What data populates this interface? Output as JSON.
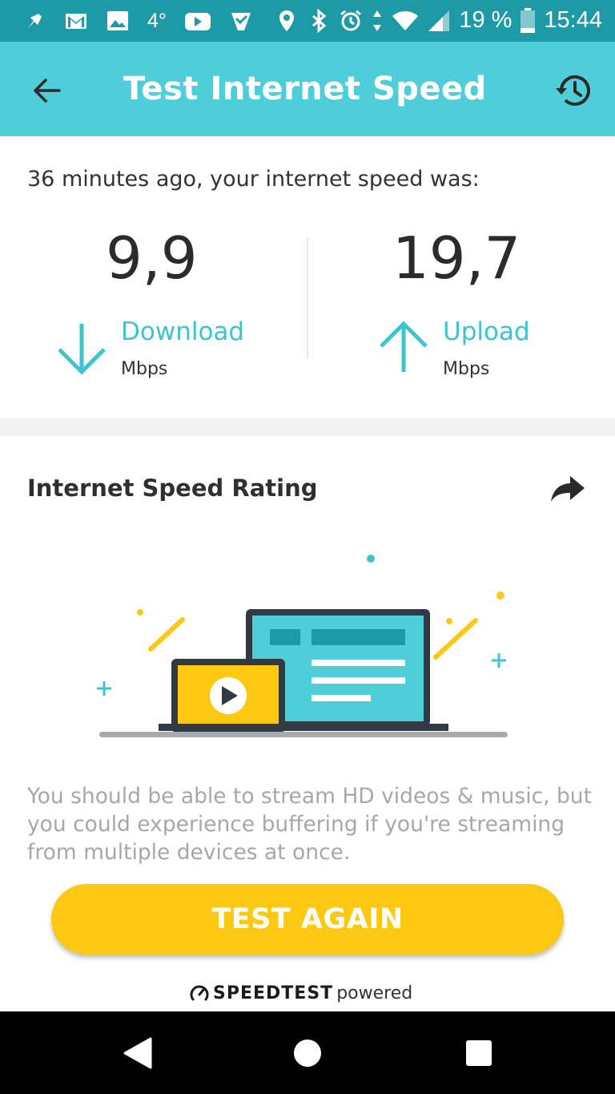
{
  "status_bar": {
    "left_icons": [
      "pin-icon",
      "gmail-icon",
      "gallery-icon",
      "temperature",
      "youtube-icon",
      "check-tag-icon"
    ],
    "temperature": "4°",
    "right_icons": [
      "location-icon",
      "bluetooth-icon",
      "alarm-icon",
      "data-arrows-icon",
      "wifi-icon",
      "signal-icon",
      "battery-icon"
    ],
    "battery": "19 %",
    "time": "15:44",
    "color": "#1d9aa6"
  },
  "app_bar": {
    "title": "Test Internet Speed",
    "back_icon": "arrow-left-icon",
    "history_icon": "history-icon",
    "color": "#4fcdd8"
  },
  "result": {
    "intro": "36 minutes ago, your internet speed was:",
    "download": {
      "value": "9,9",
      "label": "Download",
      "unit": "Mbps"
    },
    "upload": {
      "value": "19,7",
      "label": "Upload",
      "unit": "Mbps"
    },
    "accent": "#3cc4cf"
  },
  "rating": {
    "title": "Internet Speed Rating",
    "share_icon": "share-icon",
    "illustration": "laptop-and-tablet-streaming-video",
    "description": "You should be able to stream HD videos & music, but you could experience buffering if you're streaming from multiple devices at once.",
    "button_label": "TEST AGAIN",
    "button_color": "#fcc812",
    "powered_brand": "SPEEDTEST",
    "powered_suffix": "powered"
  },
  "nav_bar": {
    "buttons": [
      "back-triangle-icon",
      "home-circle-icon",
      "recents-square-icon"
    ]
  }
}
